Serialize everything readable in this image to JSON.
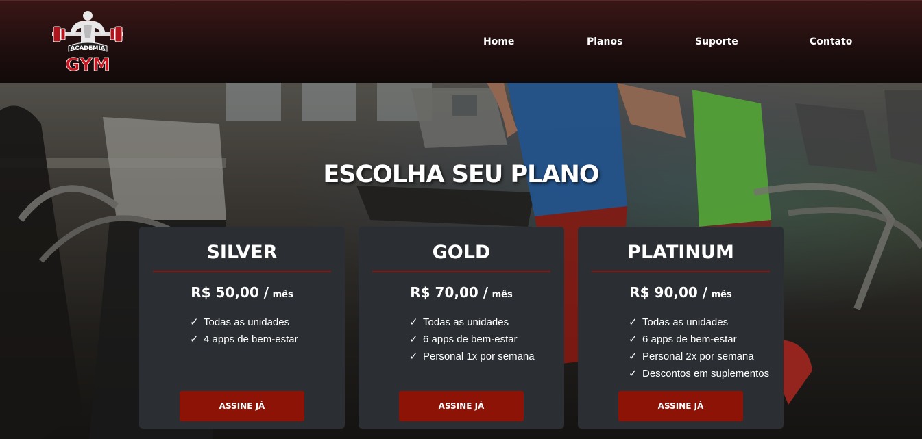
{
  "brand": {
    "logo_top_text": "ACADEMIA",
    "logo_bottom_text": "GYM",
    "accent": "#c8141e"
  },
  "nav": {
    "items": [
      "Home",
      "Planos",
      "Suporte",
      "Contato"
    ]
  },
  "hero": {
    "title": "ESCOLHA SEU PLANO"
  },
  "plans": [
    {
      "name": "SILVER",
      "price": "R$ 50,00 /",
      "period": "mês",
      "features": [
        "Todas as unidades",
        "4 apps de bem-estar"
      ],
      "cta": "ASSINE JÁ"
    },
    {
      "name": "GOLD",
      "price": "R$ 70,00 /",
      "period": "mês",
      "features": [
        "Todas as unidades",
        "6 apps de bem-estar",
        "Personal 1x por semana"
      ],
      "cta": "ASSINE JÁ"
    },
    {
      "name": "PLATINUM",
      "price": "R$ 90,00 /",
      "period": "mês",
      "features": [
        "Todas as unidades",
        "6 apps de bem-estar",
        "Personal 2x por semana",
        "Descontos em suplementos"
      ],
      "cta": "ASSINE JÁ"
    }
  ],
  "check_glyph": "✓",
  "colors": {
    "card_bg": "#2b2f33",
    "button_bg": "#8c1306",
    "divider": "#8a1410"
  }
}
